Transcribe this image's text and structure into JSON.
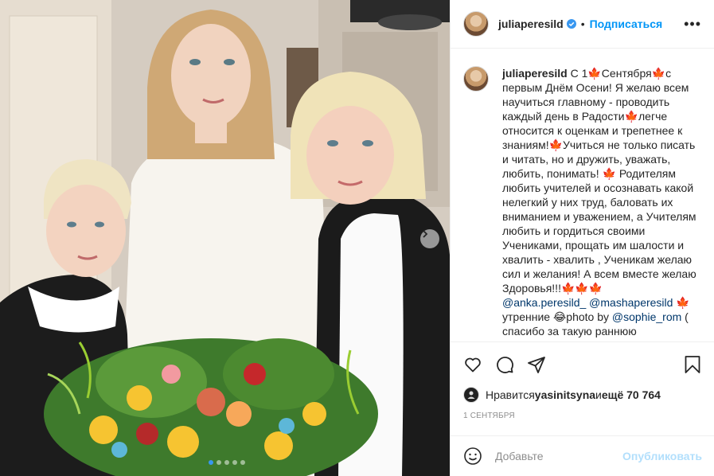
{
  "post": {
    "username": "juliaperesild",
    "separator": "•",
    "follow_label": "Подписаться",
    "more_label": "•••"
  },
  "caption": {
    "username": "juliaperesild",
    "text_part1": " С 1🍁Сентября🍁с первым Днём Осени! Я желаю всем научиться главному - проводить каждый день в Радости🍁легче относится к оценкам и трепетнее к знаниям!🍁Учиться не только писать и читать, но и дружить, уважать, любить, понимать! 🍁 Родителям любить учителей и осознавать какой нелегкий у них труд, баловать их вниманием и уважением, а Учителям любить и гордиться своими Учениками, прощать им шалости и хвалить - хвалить , Ученикам желаю сил и желания! А всем вместе желаю Здоровья!!!🍁🍁🍁\n",
    "mention1": "@anka.peresild_",
    "space": " ",
    "mention2": "@mashaperesild",
    "text_part2": " 🍁 утренние 😂photo by ",
    "mention3": "@sophie_rom",
    "text_part3": " ( спасибо за такую раннюю"
  },
  "likes": {
    "prefix": "Нравится ",
    "user": "yasinitsyna",
    "middle": " и ",
    "count": "ещё 70 764"
  },
  "date": "1 СЕНТЯБРЯ",
  "comment": {
    "placeholder": "Добавьте",
    "post_label": "Опубликовать"
  },
  "carousel": {
    "total": 5,
    "active_index": 0
  },
  "colors": {
    "accent": "#0095f6",
    "mention": "#00376b",
    "muted": "#8e8e8e",
    "verified": "#3897f0",
    "maple_leaf": "#d2691e"
  },
  "icons": [
    "verified-badge-icon",
    "more-options-icon",
    "chevron-right-icon",
    "heart-icon",
    "comment-icon",
    "share-icon",
    "bookmark-icon",
    "emoji-icon"
  ]
}
